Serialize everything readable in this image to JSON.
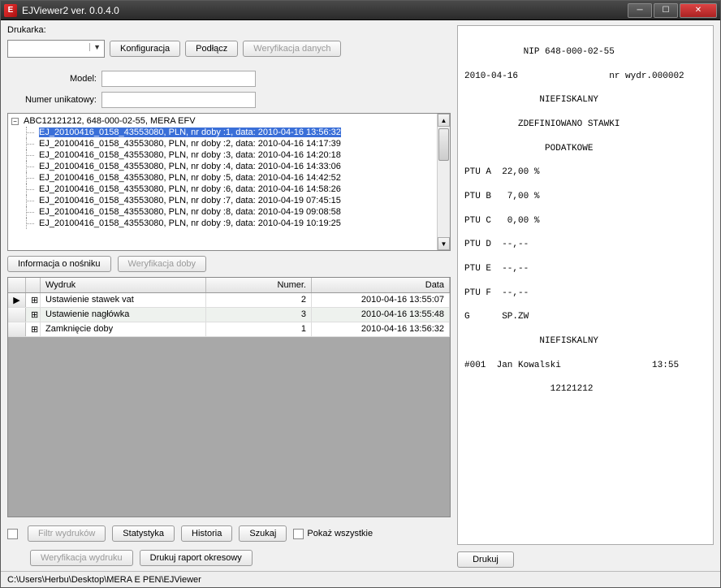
{
  "window": {
    "title": "EJViewer2 ver. 0.0.4.0"
  },
  "labels": {
    "printer": "Drukarka:",
    "model": "Model:",
    "unique_number": "Numer unikatowy:"
  },
  "buttons": {
    "config": "Konfiguracja",
    "connect": "Podłącz",
    "verify_data": "Weryfikacja danych",
    "media_info": "Informacja o nośniku",
    "verify_day": "Weryfikacja doby",
    "filter": "Filtr wydruków",
    "stats": "Statystyka",
    "history": "Historia",
    "search": "Szukaj",
    "show_all": "Pokaż wszystkie",
    "verify_print": "Weryfikacja wydruku",
    "periodic_report": "Drukuj raport okresowy",
    "print": "Drukuj"
  },
  "tree": {
    "root": "ABC12121212, 648-000-02-55, MERA EFV",
    "items": [
      "EJ_20100416_0158_43553080, PLN, nr doby :1, data: 2010-04-16 13:56:32",
      "EJ_20100416_0158_43553080, PLN, nr doby :2, data: 2010-04-16 14:17:39",
      "EJ_20100416_0158_43553080, PLN, nr doby :3, data: 2010-04-16 14:20:18",
      "EJ_20100416_0158_43553080, PLN, nr doby :4, data: 2010-04-16 14:33:06",
      "EJ_20100416_0158_43553080, PLN, nr doby :5, data: 2010-04-16 14:42:52",
      "EJ_20100416_0158_43553080, PLN, nr doby :6, data: 2010-04-16 14:58:26",
      "EJ_20100416_0158_43553080, PLN, nr doby :7, data: 2010-04-19 07:45:15",
      "EJ_20100416_0158_43553080, PLN, nr doby :8, data: 2010-04-19 09:08:58",
      "EJ_20100416_0158_43553080, PLN, nr doby :9, data: 2010-04-19 10:19:25"
    ]
  },
  "grid": {
    "headers": {
      "name": "Wydruk",
      "number": "Numer.",
      "date": "Data"
    },
    "rows": [
      {
        "name": "Ustawienie stawek vat",
        "number": "2",
        "date": "2010-04-16 13:55:07"
      },
      {
        "name": "Ustawienie nagłówka",
        "number": "3",
        "date": "2010-04-16 13:55:48"
      },
      {
        "name": "Zamknięcie doby",
        "number": "1",
        "date": "2010-04-16 13:56:32"
      }
    ]
  },
  "receipt": {
    "l1": "           NIP 648-000-02-55",
    "l2": "2010-04-16                 nr wydr.000002",
    "l3": "              NIEFISKALNY",
    "l4": "          ZDEFINIOWANO STAWKI",
    "l5": "               PODATKOWE",
    "l6": "PTU A  22,00 %",
    "l7": "PTU B   7,00 %",
    "l8": "PTU C   0,00 %",
    "l9": "PTU D  --,--",
    "l10": "PTU E  --,--",
    "l11": "PTU F  --,--",
    "l12": "G      SP.ZW",
    "l13": "              NIEFISKALNY",
    "l14": "#001  Jan Kowalski                 13:55",
    "l15": "                12121212"
  },
  "statusbar": "C:\\Users\\Herbu\\Desktop\\MERA E PEN\\EJViewer"
}
